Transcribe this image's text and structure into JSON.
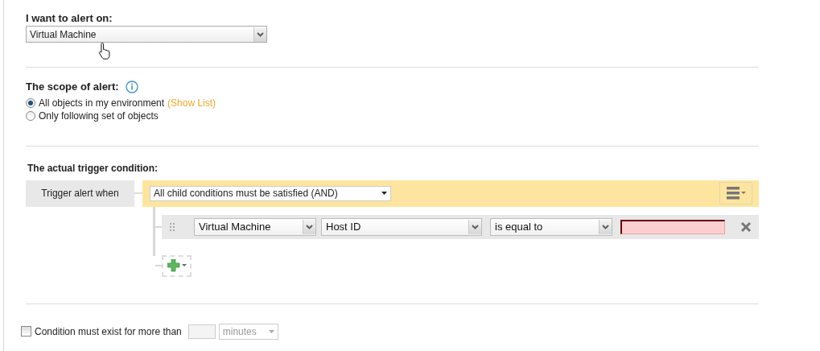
{
  "alert_on": {
    "label": "I want to alert on:",
    "value": "Virtual Machine"
  },
  "scope": {
    "label": "The scope of alert:",
    "options": [
      {
        "label": "All objects in my environment",
        "link": "(Show List)",
        "selected": true
      },
      {
        "label": "Only following set of objects",
        "selected": false
      }
    ]
  },
  "trigger": {
    "heading": "The actual trigger condition:",
    "label": "Trigger alert when",
    "mode": "All child conditions must be satisfied (AND)",
    "conditions": [
      {
        "object": "Virtual Machine",
        "attribute": "Host ID",
        "operator": "is equal to",
        "invalid": true
      }
    ]
  },
  "duration": {
    "checked": false,
    "label": "Condition must exist for more than",
    "unit": "minutes"
  }
}
